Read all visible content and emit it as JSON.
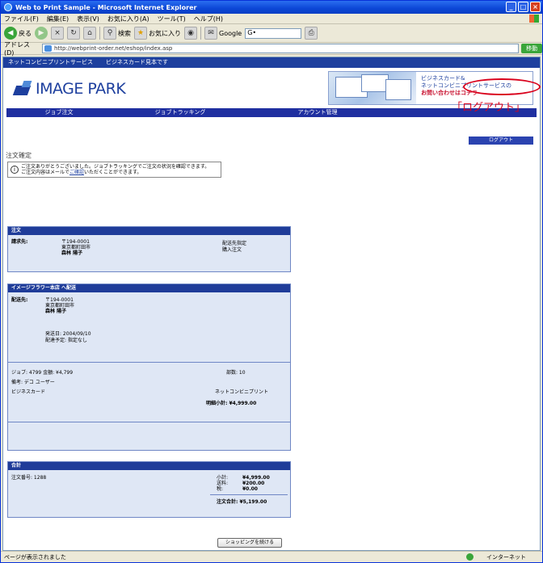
{
  "window": {
    "title": "Web to Print Sample - Microsoft Internet Explorer"
  },
  "menu": [
    "ファイル(F)",
    "編集(E)",
    "表示(V)",
    "お気に入り(A)",
    "ツール(T)",
    "ヘルプ(H)"
  ],
  "toolbar": {
    "back_label": "戻る",
    "search_label": "検索",
    "favorites_label": "お気に入り",
    "google_label": "Google",
    "search_placeholder": "G•"
  },
  "address": {
    "label": "アドレス(D)",
    "url": "http://webprint-order.net/eshop/index.asp",
    "go_label": "移動"
  },
  "site": {
    "top_strip": [
      "ネットコンビニプリントサービス",
      "ビジネスカード見本です"
    ],
    "logo": "IMAGE PARK",
    "banner": {
      "line1": "ビジネスカード&",
      "line2": "ネットコンビニプリントサービスの",
      "line3": "お問い合わせはコチラ"
    },
    "nav": [
      "ジョブ注文",
      "ジョブトラッキング",
      "アカウント管理"
    ],
    "logout": "ログアウト",
    "callout": "「ログアウト」"
  },
  "page": {
    "heading": "注文確定",
    "info_line1": "ご注文ありがとうございました。ジョブトラッキングでご注文の状況を確認できます。",
    "info_line2a": "ご注文内容はメールで",
    "info_link": "ご確認",
    "info_line2b": "いただくことができます。"
  },
  "order": {
    "head": "注文",
    "req_label": "請求先:",
    "req_zip": "〒194-0001",
    "req_addr": "東京都町田市",
    "req_name": "森林 陽子",
    "ship_method": "配送先指定",
    "pay_method": "購入注文"
  },
  "item": {
    "head": "イメージフラワー本店 へ配送",
    "ship_label": "配送先:",
    "ship_zip": "〒194-0001",
    "ship_addr": "東京都町田市",
    "ship_name": "森林 陽子",
    "date1": "発送日: 2004/09/10",
    "date2": "配達予定: 指定なし",
    "job_line": "ジョブ: 4799  金額: ¥4,799",
    "qty": "部数: 10",
    "remarks": "備考: デコ ユーザー",
    "format": "ビジネスカード",
    "type": "ネットコンビニプリント",
    "subtotal": "明細小計: ¥4,999.00"
  },
  "totals": {
    "head": "合計",
    "order_no": "注文番号: 1288",
    "rows": [
      {
        "label": "小計:",
        "value": "¥4,999.00"
      },
      {
        "label": "送料:",
        "value": "¥200.00"
      },
      {
        "label": "税:",
        "value": "¥0.00"
      }
    ],
    "grand": "注文合計: ¥5,199.00"
  },
  "shopping_button": "ショッピングを続ける",
  "status": {
    "left": "ページが表示されました",
    "right": "インターネット"
  },
  "colors": {
    "navy": "#1f2fa0",
    "panel": "#dfe7f5",
    "callout": "#d9001b"
  }
}
